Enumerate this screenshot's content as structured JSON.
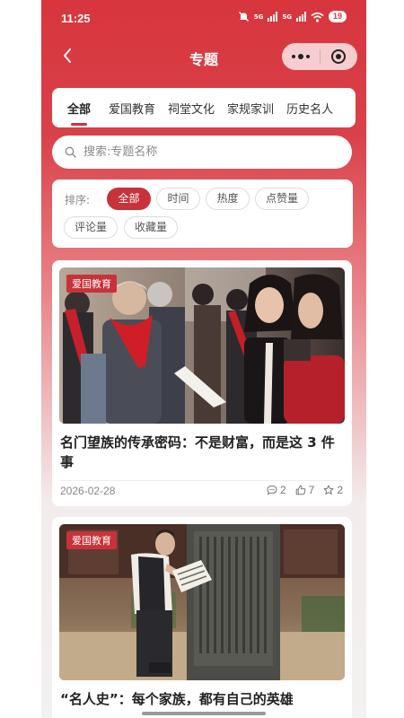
{
  "status_bar": {
    "time": "11:25",
    "network_1": "5G",
    "network_2": "5G",
    "battery": "19"
  },
  "nav": {
    "title": "专题"
  },
  "tabs": [
    {
      "label": "全部",
      "active": true
    },
    {
      "label": "爱国教育"
    },
    {
      "label": "祠堂文化"
    },
    {
      "label": "家规家训"
    },
    {
      "label": "历史名人"
    }
  ],
  "search": {
    "placeholder": "搜索:专题名称",
    "value": ""
  },
  "sort": {
    "label": "排序:",
    "options": [
      {
        "label": "全部",
        "active": true
      },
      {
        "label": "时间"
      },
      {
        "label": "热度"
      },
      {
        "label": "点赞量"
      },
      {
        "label": "评论量"
      },
      {
        "label": "收藏量"
      }
    ]
  },
  "articles": [
    {
      "tag": "爱国教育",
      "title": "名门望族的传承密码：不是财富，而是这 3 件事",
      "date": "2026-02-28",
      "comments": "2",
      "likes": "7",
      "favorites": "2"
    },
    {
      "tag": "爱国教育",
      "title": "“名人史”：每个家族，都有自己的英雄"
    }
  ],
  "colors": {
    "primary": "#c8323a",
    "header_red": "#d8353d"
  }
}
